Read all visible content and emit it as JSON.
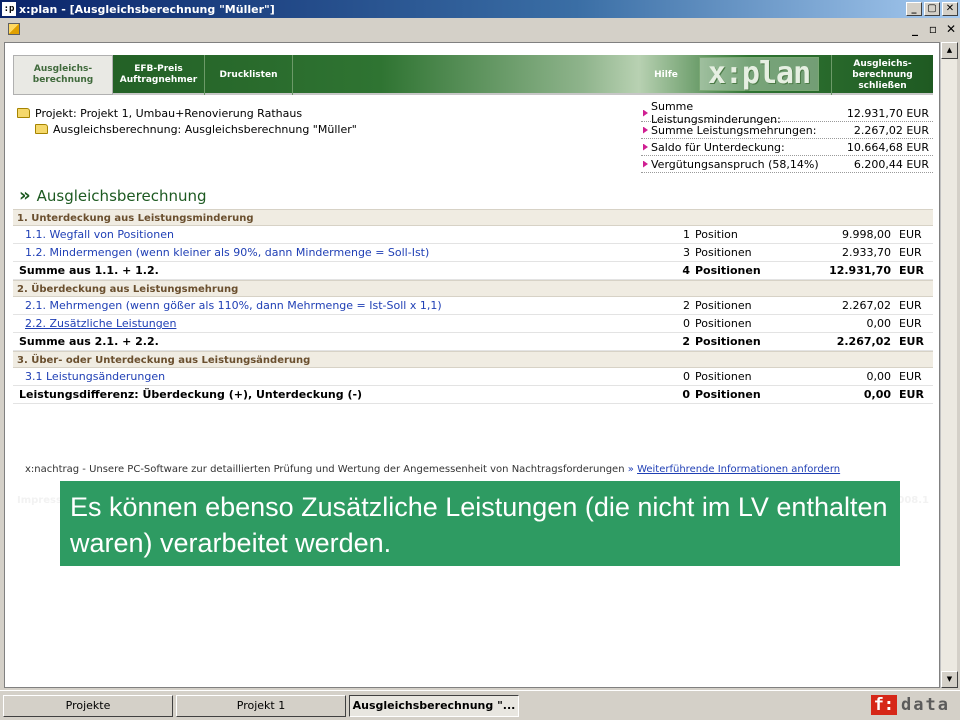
{
  "window": {
    "title": "x:plan - [Ausgleichsberechnung \"Müller\"]",
    "app_icon": ":p",
    "controls": [
      "_",
      "▢",
      "✕"
    ]
  },
  "mdi": {
    "controls": [
      "_",
      "▫",
      "✕"
    ]
  },
  "nav": {
    "tabs": [
      {
        "label": "Ausgleichs-\nberechnung",
        "active": true
      },
      {
        "label": "EFB-Preis\nAuftragnehmer",
        "active": false
      },
      {
        "label": "Drucklisten",
        "active": false
      }
    ],
    "help": "Hilfe",
    "logo": "x:plan",
    "close_label": "Ausgleichs-\nberechnung\nschließen"
  },
  "project": {
    "project_line": "Projekt: Projekt 1, Umbau+Renovierung Rathaus",
    "calc_line": "Ausgleichsberechnung: Ausgleichsberechnung \"Müller\""
  },
  "summary": [
    {
      "label": "Summe Leistungsminderungen:",
      "value": "12.931,70 EUR"
    },
    {
      "label": "Summe Leistungsmehrungen:",
      "value": "2.267,02 EUR"
    },
    {
      "label": "Saldo für Unterdeckung:",
      "value": "10.664,68 EUR"
    },
    {
      "label": "Vergütungsanspruch (58,14%)",
      "value": "6.200,44 EUR"
    }
  ],
  "heading": {
    "chevron": "»",
    "title": "Ausgleichsberechnung"
  },
  "sections": {
    "s1": "1. Unterdeckung aus Leistungsminderung",
    "s2": "2. Überdeckung aus Leistungsmehrung",
    "s3": "3. Über- oder Unterdeckung aus Leistungsänderung"
  },
  "rows": {
    "r11": {
      "label": "1.1. Wegfall von Positionen",
      "count": "1",
      "unit": "Position",
      "value": "9.998,00",
      "cur": "EUR"
    },
    "r12": {
      "label": "1.2. Mindermengen (wenn kleiner als 90%, dann Mindermenge = Soll-Ist)",
      "count": "3",
      "unit": "Positionen",
      "value": "2.933,70",
      "cur": "EUR"
    },
    "sum1": {
      "label": "Summe aus 1.1. + 1.2.",
      "count": "4",
      "unit": "Positionen",
      "value": "12.931,70",
      "cur": "EUR"
    },
    "r21": {
      "label": "2.1. Mehrmengen (wenn gößer als 110%, dann Mehrmenge = Ist-Soll x 1,1)",
      "count": "2",
      "unit": "Positionen",
      "value": "2.267,02",
      "cur": "EUR"
    },
    "r22": {
      "label": "2.2. Zusätzliche Leistungen",
      "count": "0",
      "unit": "Positionen",
      "value": "0,00",
      "cur": "EUR"
    },
    "sum2": {
      "label": "Summe aus 2.1. + 2.2.",
      "count": "2",
      "unit": "Positionen",
      "value": "2.267,02",
      "cur": "EUR"
    },
    "r31": {
      "label": "3.1 Leistungsänderungen",
      "count": "0",
      "unit": "Positionen",
      "value": "0,00",
      "cur": "EUR"
    },
    "diff": {
      "label": "Leistungsdifferenz: Überdeckung (+), Unterdeckung (-)",
      "count": "0",
      "unit": "Positionen",
      "value": "0,00",
      "cur": "EUR"
    }
  },
  "footnote": {
    "text": "x:nachtrag - Unsere PC-Software zur detaillierten Prüfung und Wertung der Angemessenheit von Nachtragsforderungen",
    "raquo": "»",
    "link": "Weiterführende Informationen anfordern"
  },
  "footer": {
    "left": "Impressum",
    "right": "x:plan - Version 2008.1"
  },
  "overlay": {
    "text": "Es können ebenso Zusätzliche Leistungen (die nicht im LV enthalten waren) verarbeitet werden."
  },
  "taskbar": {
    "items": [
      {
        "label": "Projekte",
        "active": false
      },
      {
        "label": "Projekt 1",
        "active": false
      },
      {
        "label": "Ausgleichsberechnung \"...",
        "active": true
      }
    ],
    "brand_f": "f:",
    "brand_rest": "data"
  },
  "colors": {
    "accent_green": "#2f7432",
    "overlay_green": "#2e9b62",
    "link_blue": "#1f3fb5",
    "bullet_magenta": "#d01f92"
  }
}
